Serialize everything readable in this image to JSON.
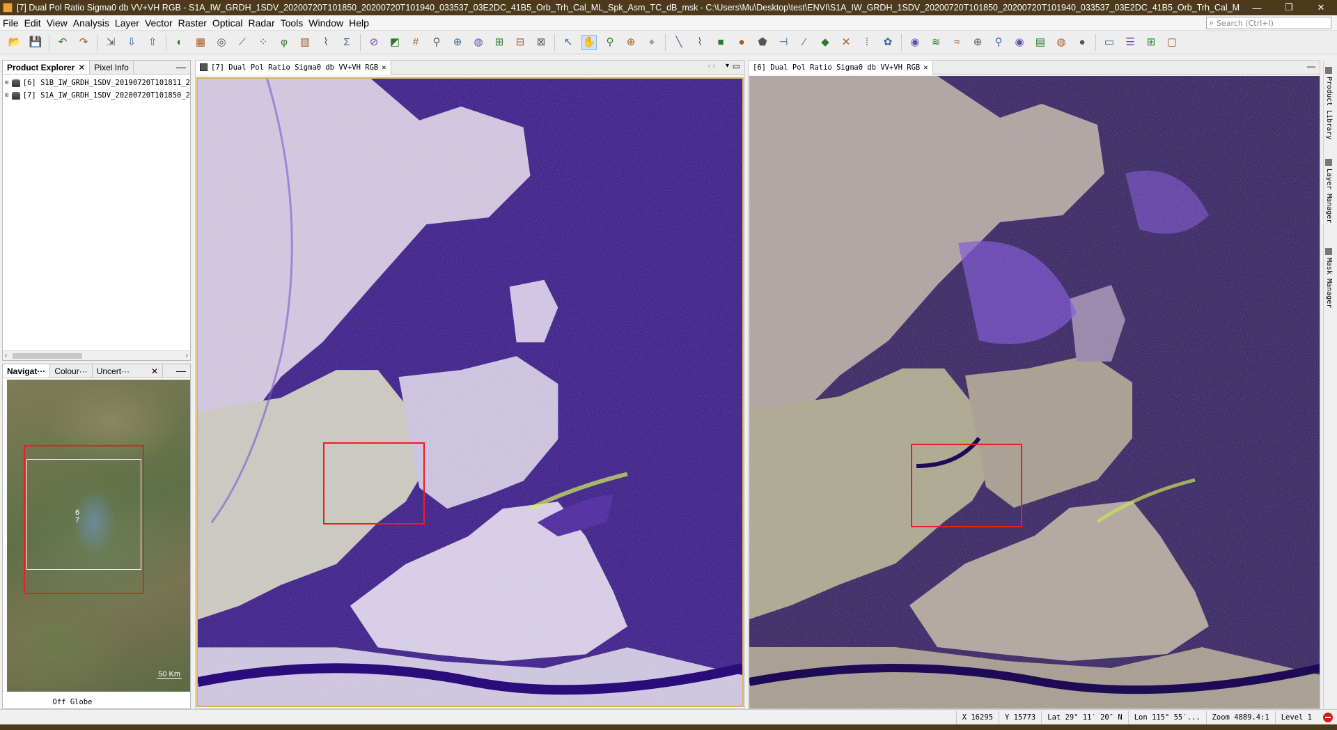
{
  "window": {
    "title": "[7] Dual Pol Ratio Sigma0 db VV+VH RGB - S1A_IW_GRDH_1SDV_20200720T101850_20200720T101940_033537_03E2DC_41B5_Orb_Trh_Cal_ML_Spk_Asm_TC_dB_msk - C:\\Users\\Mu\\Desktop\\test\\ENVI\\S1A_IW_GRDH_1SDV_20200720T101850_20200720T101940_033537_03E2DC_41B5_Orb_Trh_Cal_M",
    "minimize": "—",
    "restore": "❐",
    "close": "✕"
  },
  "menu": [
    "File",
    "Edit",
    "View",
    "Analysis",
    "Layer",
    "Vector",
    "Raster",
    "Optical",
    "Radar",
    "Tools",
    "Window",
    "Help"
  ],
  "search": {
    "placeholder": "Search (Ctrl+I)"
  },
  "toolbar": {
    "icons": [
      "open-product-icon",
      "save-product-icon",
      "undo-icon",
      "redo-icon",
      "import-vector-icon",
      "import-raster-icon",
      "export-icon",
      "colour-manipulation-icon",
      "band-maths-icon",
      "statistics-icon",
      "profile-plot-icon",
      "scatter-plot-icon",
      "spectrum-icon",
      "histogram-icon",
      "time-series-icon",
      "sum-icon",
      "range-finder-icon",
      "mask-icon",
      "graticule-icon",
      "pin-icon",
      "gcp-icon",
      "world-map-icon",
      "tile-horizontal-icon",
      "tile-vertical-icon",
      "tile-grid-icon",
      "select-tool-icon",
      "pan-tool-icon",
      "zoom-tool-icon",
      "zoom-gcp-icon",
      "gcp-placement-icon",
      "line-draw-icon",
      "polyline-draw-icon",
      "rectangle-draw-icon",
      "ellipse-draw-icon",
      "polygon-draw-icon",
      "measure-icon",
      "magic-wand-icon",
      "pin-manager-icon",
      "vector-data-icon",
      "ioi-icon",
      "gcp-manager-icon",
      "wind-icon",
      "ocean-icon",
      "flood-icon",
      "gcp-tool-icon",
      "search-product-icon",
      "eye-icon",
      "plot-icon",
      "globe-icon",
      "sphere-icon",
      "layout-1-icon",
      "layout-2-icon",
      "layout-3-icon",
      "layout-4-icon"
    ]
  },
  "product_explorer": {
    "tabs": [
      "Product Explorer",
      "Pixel Info"
    ],
    "items": [
      {
        "label": "[6]  S1B_IW_GRDH_1SDV_20190720T101811_2"
      },
      {
        "label": "[7]  S1A_IW_GRDH_1SDV_20200720T101850_2"
      }
    ]
  },
  "navigation": {
    "tabs": [
      "Navigat···",
      "Colour···",
      "Uncert···"
    ],
    "labels": [
      "6",
      "7"
    ],
    "scale": "50 Km",
    "footer": "Off Globe"
  },
  "views": {
    "left_tab": "[7] Dual Pol Ratio Sigma0 db VV+VH RGB",
    "right_tab": "[6] Dual Pol Ratio Sigma0 db VV+VH RGB"
  },
  "side_tools": [
    "Product Library",
    "Layer Manager",
    "Mask Manager"
  ],
  "status": {
    "x": "X  16295",
    "y": "Y  15773",
    "lat": "Lat 29° 11′ 20″ N",
    "lon": "Lon 115° 55′...",
    "zoom": "Zoom 4889.4:1",
    "level": "Level 1"
  },
  "colors": {
    "title_bg": "#4d3a1c",
    "selection": "#f01c1c",
    "water": "#2a0c7a",
    "land": "#c9c0d8"
  }
}
